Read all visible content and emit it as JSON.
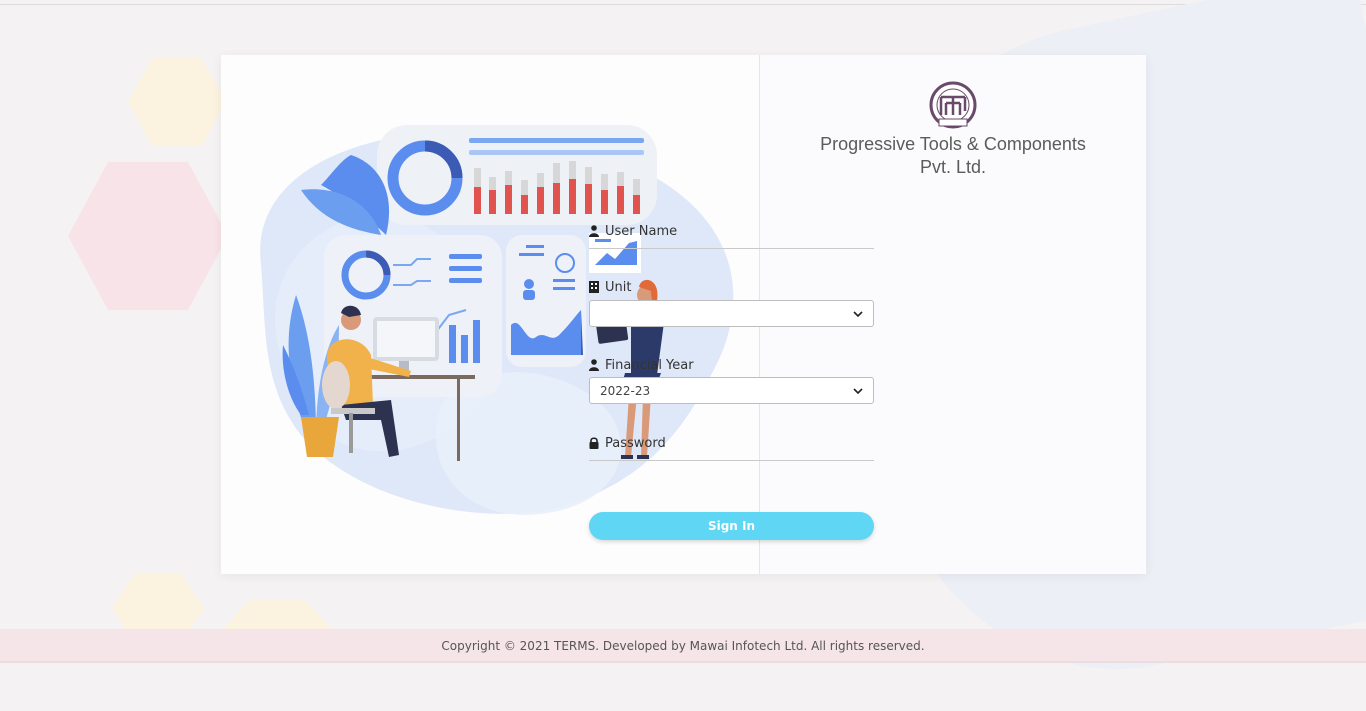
{
  "company": {
    "name_line1": "Progressive Tools & Components",
    "name_line2": "Pvt. Ltd.",
    "logo_icon": "ptc-precision-logo"
  },
  "form": {
    "username": {
      "label": "User Name",
      "icon": "user-icon",
      "value": ""
    },
    "unit": {
      "label": "Unit",
      "icon": "building-icon",
      "value": ""
    },
    "financial_year": {
      "label": "Financial Year",
      "icon": "user-icon",
      "value": "2022-23"
    },
    "password": {
      "label": "Password",
      "icon": "lock-icon",
      "value": ""
    },
    "signin_label": "Sign In"
  },
  "footer": {
    "text": "Copyright © 2021 TERMS. Developed by Mawai Infotech Ltd. All rights reserved."
  },
  "colors": {
    "accent": "#5fd6f4",
    "background": "#f5f2f3",
    "footer_bg": "#f5e5e9",
    "bar_red": "#e0534f",
    "chart_blue": "#5b8def"
  }
}
